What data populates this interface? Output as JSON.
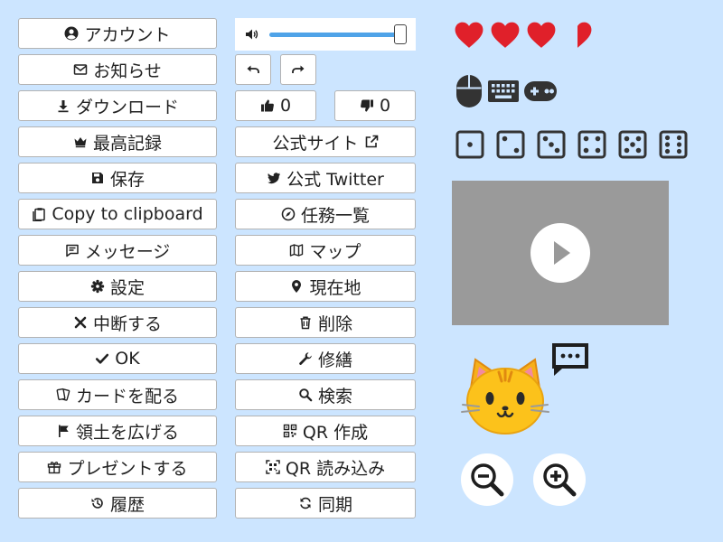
{
  "buttons_left": {
    "account": "アカウント",
    "notice": "お知らせ",
    "download": "ダウンロード",
    "high_score": "最高記録",
    "save": "保存",
    "copy": "Copy to clipboard",
    "message": "メッセージ",
    "settings": "設定",
    "abort": "中断する",
    "ok": "OK",
    "deal_cards": "カードを配る",
    "expand_territory": "領土を広げる",
    "present": "プレゼントする",
    "history": "履歴"
  },
  "buttons_right": {
    "official_site": "公式サイト",
    "official_twitter": "公式 Twitter",
    "mission_list": "任務一覧",
    "map": "マップ",
    "current_location": "現在地",
    "delete": "削除",
    "repair": "修繕",
    "search": "検索",
    "qr_create": "QR 作成",
    "qr_read": "QR 読み込み",
    "sync": "同期"
  },
  "volume": {
    "level": 0.97
  },
  "likes": {
    "up_count": "0",
    "down_count": "0"
  },
  "hearts": {
    "full": 3,
    "half": 1,
    "color": "#e0202a"
  },
  "devices": [
    "mouse-icon",
    "keyboard-icon",
    "gamepad-icon"
  ],
  "dice": [
    1,
    2,
    3,
    4,
    5,
    6
  ],
  "video": {
    "background": "#9a9a9a"
  },
  "colors": {
    "background": "#cce5ff",
    "accent": "#4fa3e8",
    "icon_dark": "#333333"
  }
}
